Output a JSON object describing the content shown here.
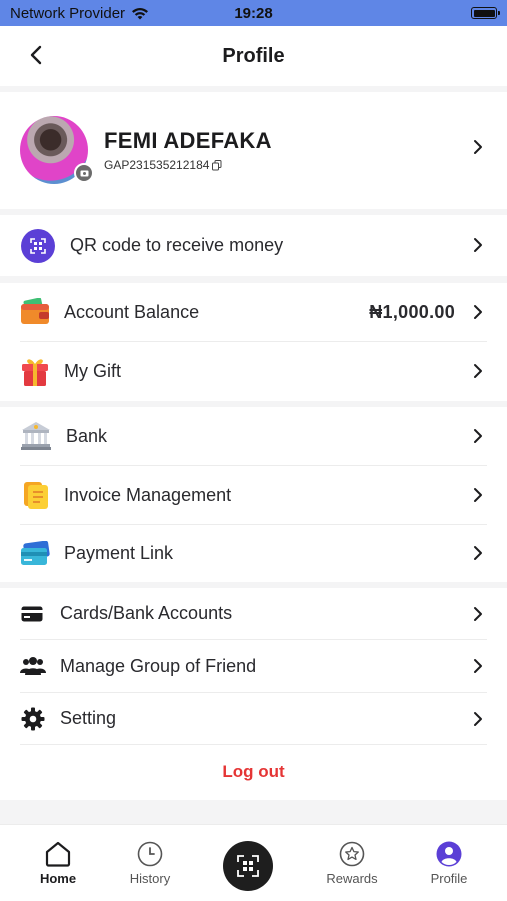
{
  "status_bar": {
    "carrier": "Network Provider",
    "time": "19:28"
  },
  "header": {
    "title": "Profile"
  },
  "profile": {
    "name": "FEMI ADEFAKA",
    "id": "GAP231535212184"
  },
  "qr_row": {
    "label": "QR code to receive money"
  },
  "wallet_section": {
    "account_balance_label": "Account Balance",
    "account_balance_value": "₦1,000.00",
    "my_gift_label": "My Gift"
  },
  "business_section": {
    "bank_label": "Bank",
    "invoice_label": "Invoice Management",
    "payment_link_label": "Payment Link"
  },
  "settings_section": {
    "cards_label": "Cards/Bank Accounts",
    "group_label": "Manage Group of Friend",
    "setting_label": "Setting",
    "logout_label": "Log out"
  },
  "tab_bar": {
    "home": "Home",
    "history": "History",
    "rewards": "Rewards",
    "profile": "Profile",
    "active": "Home"
  },
  "colors": {
    "status_bar": "#5f86e6",
    "accent_purple": "#5b3fd6",
    "logout_red": "#e53535"
  }
}
